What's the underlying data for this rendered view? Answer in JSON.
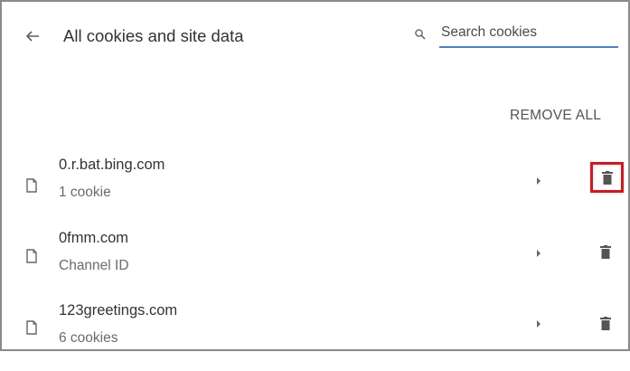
{
  "header": {
    "title": "All cookies and site data",
    "back_icon": "arrow-left-icon"
  },
  "search": {
    "placeholder": "Search cookies",
    "value": "",
    "icon": "search-icon",
    "underline_color": "#4a7fd4"
  },
  "actions": {
    "remove_all_label": "REMOVE ALL"
  },
  "sites": [
    {
      "name": "0.r.bat.bing.com",
      "detail": "1 cookie",
      "highlighted": true
    },
    {
      "name": "0fmm.com",
      "detail": "Channel ID",
      "highlighted": false
    },
    {
      "name": "123greetings.com",
      "detail": "6 cookies",
      "highlighted": false
    }
  ],
  "colors": {
    "highlight_border": "#e0101b",
    "text_primary": "#333333",
    "text_secondary": "#6b6b6b"
  }
}
